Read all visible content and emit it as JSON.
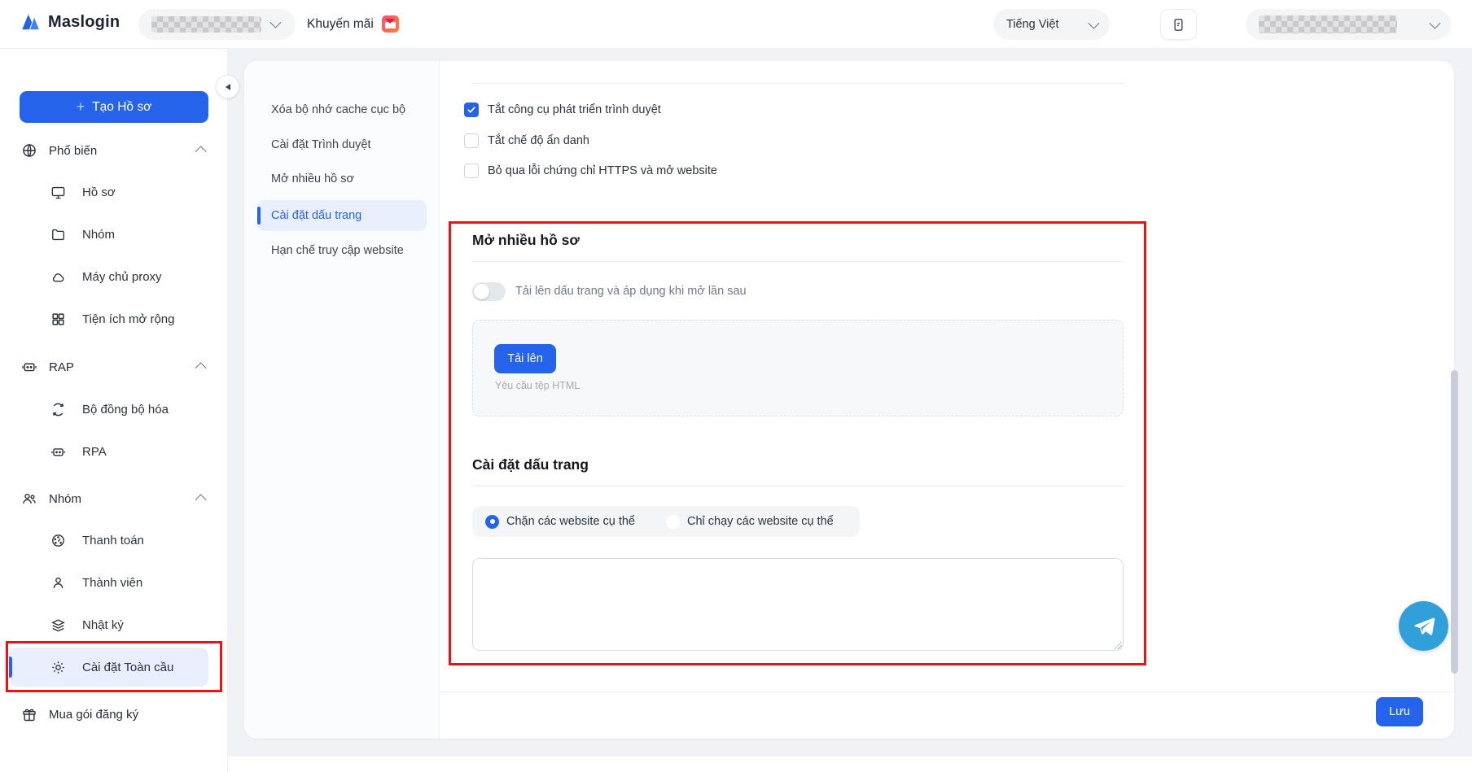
{
  "header": {
    "logo_text": "Maslogin",
    "promo_label": "Khuyến mãi",
    "language_selector": "Tiếng Việt"
  },
  "sidebar": {
    "create_plus": "+",
    "create_button": "Tạo Hồ sơ",
    "sections": [
      {
        "label": "Phổ biến",
        "items": [
          "Hồ sơ",
          "Nhóm",
          "Máy chủ proxy",
          "Tiện ích mở rộng"
        ]
      },
      {
        "label": "RAP",
        "items": [
          "Bộ đồng bộ hóa",
          "RPA"
        ]
      },
      {
        "label": "Nhóm",
        "items": [
          "Thanh toán",
          "Thành viên",
          "Nhật ký",
          "Cài đặt Toàn cầu"
        ]
      }
    ],
    "active_item": "Cài đặt Toàn cầu",
    "footer_item": "Mua gói đăng ký"
  },
  "subnav": {
    "items": [
      "Xóa bộ nhớ cache cục bộ",
      "Cài đặt Trình duyệt",
      "Mở nhiều hồ sơ",
      "Cài đặt dấu trang",
      "Hạn chế truy cập website"
    ],
    "active": "Cài đặt dấu trang"
  },
  "content": {
    "checkboxes": [
      {
        "label": "Tắt công cụ phát triển trình duyệt",
        "checked": true
      },
      {
        "label": "Tắt chế độ ẩn danh",
        "checked": false
      },
      {
        "label": "Bỏ qua lỗi chứng chỉ HTTPS và mở website",
        "checked": false
      }
    ],
    "multi_profile": {
      "title": "Mở nhiều hồ sơ",
      "toggle_label": "Tải lên dấu trang và áp dụng khi mở lần sau",
      "toggle_on": false,
      "upload_button": "Tải lên",
      "upload_hint": "Yêu cầu tệp HTML"
    },
    "bookmark": {
      "title": "Cài đặt dấu trang",
      "radio_options": [
        {
          "label": "Chặn các website cụ thể",
          "selected": true
        },
        {
          "label": "Chỉ chạy các website cụ thể",
          "selected": false
        }
      ],
      "textarea_value": ""
    },
    "save_button": "Lưu"
  },
  "colors": {
    "primary_blue": "#2563eb",
    "active_bg": "#e9effc",
    "annotation_red": "#ee1111",
    "telegram_blue": "#31a0da",
    "page_bg": "#f0f2f5"
  }
}
